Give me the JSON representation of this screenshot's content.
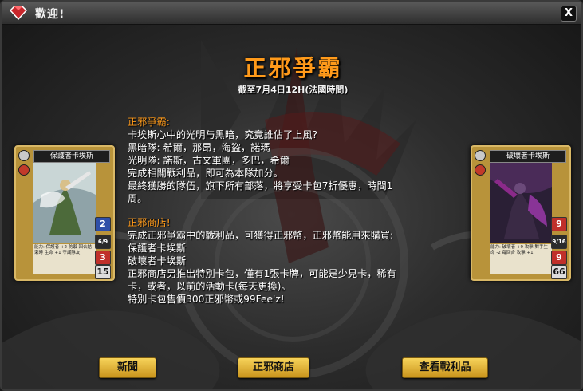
{
  "window": {
    "title": "歡迎!",
    "close_label": "X"
  },
  "main": {
    "title": "正邪爭霸",
    "subtitle": "截至7月4日12H(法國時間)",
    "section1_heading": "正邪爭霸:",
    "section1_lines": [
      "卡埃斯心中的光明与黑暗，究竟誰佔了上風?",
      "黑暗隊: 希爾，那昂，海盜，諾瑪",
      "光明隊: 諾斯，古文軍團，多巴，希爾",
      "完成相關戰利品，即可為本隊加分。",
      "最終獲勝的隊伍，旗下所有部落，將享受卡包7折優惠，時間1",
      "周。"
    ],
    "section2_heading": "正邪商店!",
    "section2_lines": [
      "完成正邪爭霸中的戰利品，可獲得正邪幣，正邪幣能用來購買:",
      "保護者卡埃斯",
      "破壞者卡埃斯",
      "正邪商店另推出特別卡包，僅有1張卡牌，可能是少見卡，稀有",
      "卡，或者，以前的活動卡(每天更換)。",
      "特別卡包售價300正邪幣或99Fee'z!"
    ]
  },
  "cards": {
    "left": {
      "name": "保護者卡埃斯",
      "power": "2",
      "damage": "6/9",
      "stat3": "3",
      "stat4": "15",
      "desc": "能力: 保護者 +2 防禦 回合結束時 生命 +1 守護隊友"
    },
    "right": {
      "name": "破壞者卡埃斯",
      "power": "9",
      "damage": "9/16",
      "stat3": "9",
      "stat4": "66",
      "desc": "能力: 破壞者 +9 攻擊 對手生命 -2 每回合 攻擊 +1"
    }
  },
  "buttons": {
    "news": "新聞",
    "shop": "正邪商店",
    "loot": "查看戰利品"
  },
  "colors": {
    "accent_orange": "#ff9a1a",
    "button_gold": "#e8b93a"
  }
}
